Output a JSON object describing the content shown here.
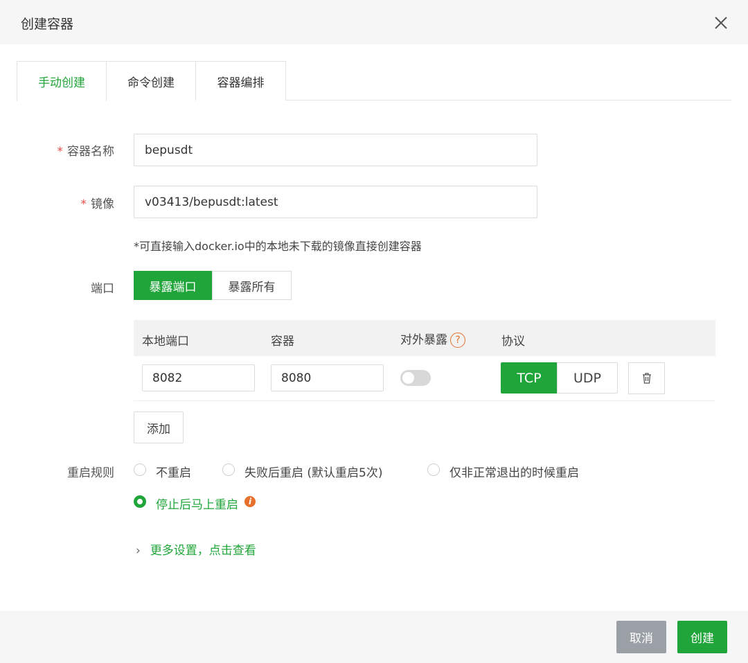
{
  "dialog": {
    "title": "创建容器"
  },
  "tabs": [
    {
      "label": "手动创建",
      "active": true
    },
    {
      "label": "命令创建",
      "active": false
    },
    {
      "label": "容器编排",
      "active": false
    }
  ],
  "form": {
    "name": {
      "label": "容器名称",
      "value": "bepusdt"
    },
    "image": {
      "label": "镜像",
      "value": "v03413/bepusdt:latest"
    },
    "image_hint": "*可直接输入docker.io中的本地未下载的镜像直接创建容器",
    "ports": {
      "label": "端口",
      "expose_port_label": "暴露端口",
      "expose_all_label": "暴露所有",
      "selected_mode": "暴露端口",
      "columns": {
        "local": "本地端口",
        "container": "容器",
        "external": "对外暴露",
        "help": "?",
        "protocol": "协议"
      },
      "rows": [
        {
          "local": "8082",
          "container": "8080",
          "external_enabled": false,
          "protocol": "TCP",
          "tcp_label": "TCP",
          "udp_label": "UDP"
        }
      ],
      "add_label": "添加"
    },
    "restart": {
      "label": "重启规则",
      "options": [
        {
          "label": "不重启",
          "selected": false
        },
        {
          "label": "失败后重启 (默认重启5次)",
          "selected": false
        },
        {
          "label": "仅非正常退出的时候重启",
          "selected": false
        },
        {
          "label": "停止后马上重启",
          "selected": true
        }
      ],
      "info_icon": "i"
    },
    "more_settings": {
      "chevron": "›",
      "label": "更多设置，点击查看"
    }
  },
  "footer": {
    "cancel_label": "取消",
    "create_label": "创建"
  },
  "colors": {
    "accent": "#20a53a",
    "warning": "#e7702c",
    "required": "#ef4b4b",
    "cancel_bg": "#9aa0a6"
  },
  "icons": {
    "close": "close-icon",
    "trash": "trash-icon",
    "help": "question-circle-icon",
    "info": "info-icon",
    "chevron": "chevron-right-icon"
  }
}
